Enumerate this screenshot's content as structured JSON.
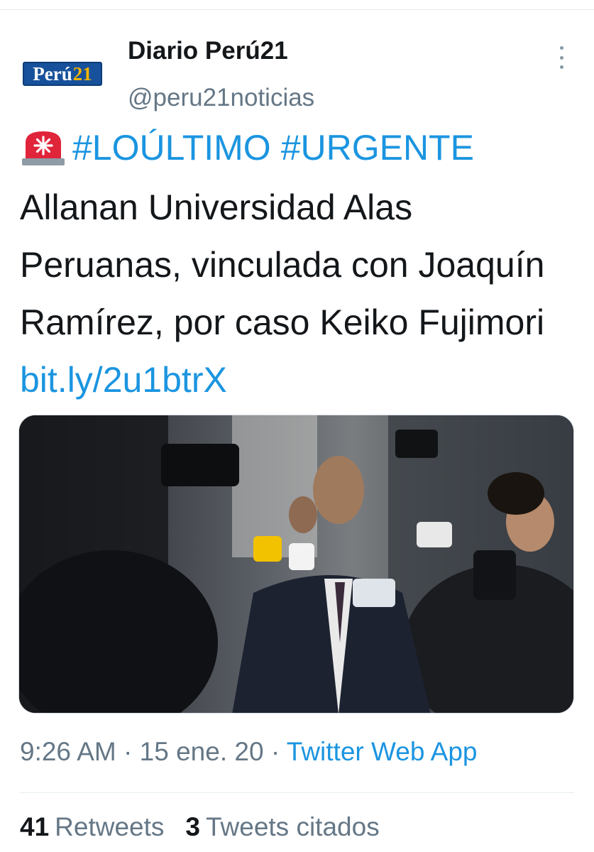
{
  "account": {
    "display_name": "Diario Perú21",
    "handle": "@peru21noticias",
    "logo_text_main": "Perú",
    "logo_text_num": "21"
  },
  "tweet": {
    "hashtags": [
      "#LOÚLTIMO",
      "#URGENTE"
    ],
    "body": "Allanan Universidad Alas Peruanas, vinculada con Joaquín Ramírez, por caso Keiko Fujimori",
    "link": "bit.ly/2u1btrX"
  },
  "meta": {
    "time": "9:26 AM",
    "separator": "·",
    "date": "15 ene. 20",
    "source": "Twitter Web App"
  },
  "stats": {
    "retweets_count": "41",
    "retweets_label": "Retweets",
    "quotes_count": "3",
    "quotes_label": "Tweets citados"
  },
  "icons": {
    "siren": "police-light-emoji",
    "more": "more-vertical-icon"
  },
  "colors": {
    "link": "#1b95e0",
    "secondary_text": "#657786",
    "logo_blue": "#17519b",
    "logo_yellow": "#f4b400"
  }
}
